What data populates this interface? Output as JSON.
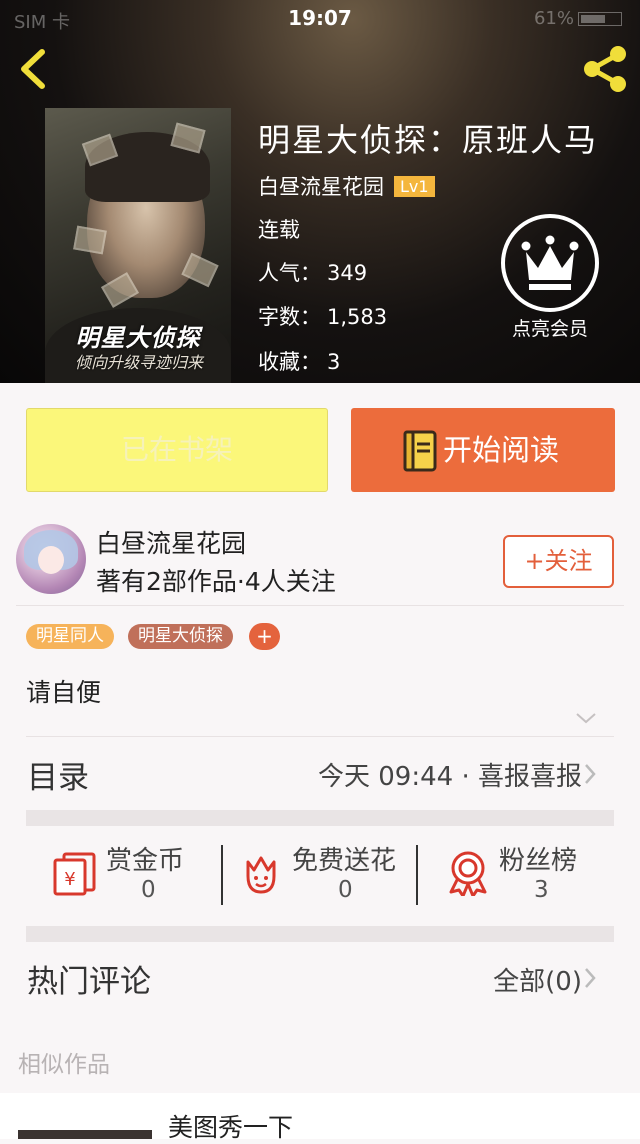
{
  "status_bar": {
    "carrier": "SIM 卡",
    "time": "19:07",
    "battery": "61%"
  },
  "book": {
    "title": "明星大侦探：原班人马",
    "author": "白昼流星花园",
    "level": "Lv1",
    "status": "连载",
    "stats": [
      {
        "label": "人气：",
        "value": "349"
      },
      {
        "label": "字数：",
        "value": "1,583"
      },
      {
        "label": "收藏：",
        "value": "3"
      }
    ],
    "cover": {
      "title": "明星大侦探",
      "subtitle": "倾向升级寻迹归来"
    }
  },
  "vip": {
    "label": "点亮会员"
  },
  "actions": {
    "shelf_label": "已在书架",
    "read_label": "开始阅读"
  },
  "author_card": {
    "name": "白昼流星花园",
    "meta": "著有2部作品·4人关注",
    "follow_label": "+关注"
  },
  "tags": [
    "明星同人",
    "明星大侦探"
  ],
  "tag_add_label": "+",
  "intro": "请自便",
  "toc": {
    "label": "目录",
    "latest": "今天 09:44 · 喜报喜报"
  },
  "rewards": [
    {
      "label": "赏金币",
      "count": "0",
      "icon": "coin-envelope-icon"
    },
    {
      "label": "免费送花",
      "count": "0",
      "icon": "flower-icon"
    },
    {
      "label": "粉丝榜",
      "count": "3",
      "icon": "medal-icon"
    }
  ],
  "comments": {
    "label": "热门评论",
    "all_label": "全部(0)"
  },
  "similar": {
    "label": "相似作品",
    "items": [
      {
        "title": "美图秀一下"
      }
    ]
  },
  "colors": {
    "accent": "#ec6c3c",
    "shelf_yellow": "#fbf77a",
    "follow": "#e35f3b",
    "level_badge": "#f4b63d"
  }
}
